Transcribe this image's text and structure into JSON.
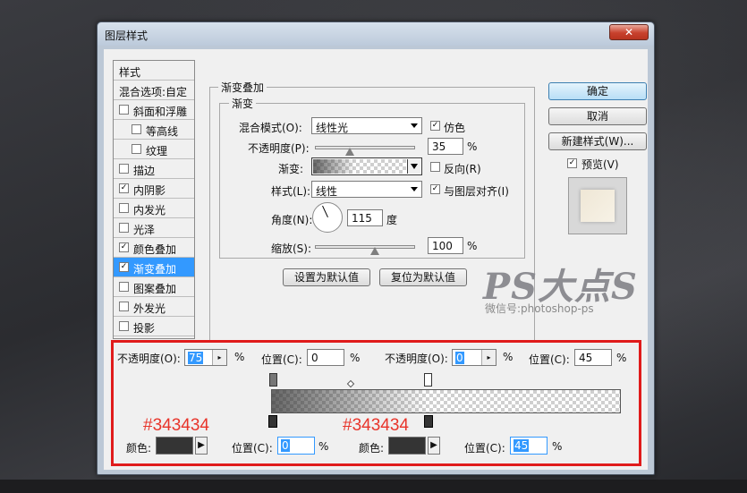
{
  "dialog": {
    "title": "图层样式",
    "close_label": "✕"
  },
  "style_list": {
    "header": "样式",
    "blend_options": "混合选项:自定",
    "items": [
      {
        "label": "斜面和浮雕",
        "checked": false
      },
      {
        "label": "等高线",
        "checked": false
      },
      {
        "label": "纹理",
        "checked": false
      },
      {
        "label": "描边",
        "checked": false
      },
      {
        "label": "内阴影",
        "checked": true
      },
      {
        "label": "内发光",
        "checked": false
      },
      {
        "label": "光泽",
        "checked": false
      },
      {
        "label": "颜色叠加",
        "checked": true
      },
      {
        "label": "渐变叠加",
        "checked": true
      },
      {
        "label": "图案叠加",
        "checked": false
      },
      {
        "label": "外发光",
        "checked": false
      },
      {
        "label": "投影",
        "checked": false
      }
    ]
  },
  "gradient_overlay": {
    "group_title": "渐变叠加",
    "subgroup_title": "渐变",
    "blend_mode_label": "混合模式(O):",
    "blend_mode_value": "线性光",
    "dither_label": "仿色",
    "opacity_label": "不透明度(P):",
    "opacity_value": "35",
    "opacity_unit": "%",
    "opacity_level": 0.35,
    "gradient_label": "渐变:",
    "reverse_label": "反向(R)",
    "style_label": "样式(L):",
    "style_value": "线性",
    "align_label": "与图层对齐(I)",
    "angle_label": "角度(N):",
    "angle_value": "115",
    "angle_unit": "度",
    "scale_label": "缩放(S):",
    "scale_value": "100",
    "scale_unit": "%",
    "scale_level": 0.6,
    "make_default": "设置为默认值",
    "reset_default": "复位为默认值"
  },
  "right_buttons": {
    "ok": "确定",
    "cancel": "取消",
    "new_style": "新建样式(W)...",
    "preview_label": "预览(V)"
  },
  "gradient_editor": {
    "opacity_label": "不透明度(O):",
    "opacity_left_value": "75",
    "opacity_right_value": "0",
    "percent": "%",
    "location_label": "位置(C):",
    "location_top_left": "0",
    "location_top_right": "45",
    "color_label": "颜色:",
    "location_bottom_left": "0",
    "location_bottom_right": "45",
    "color_hex_left": "#343434",
    "color_hex_right": "#343434",
    "swatch_color": "#343434"
  },
  "watermark": {
    "logo": "PS大点S",
    "sub": "微信号:photoshop-ps"
  }
}
